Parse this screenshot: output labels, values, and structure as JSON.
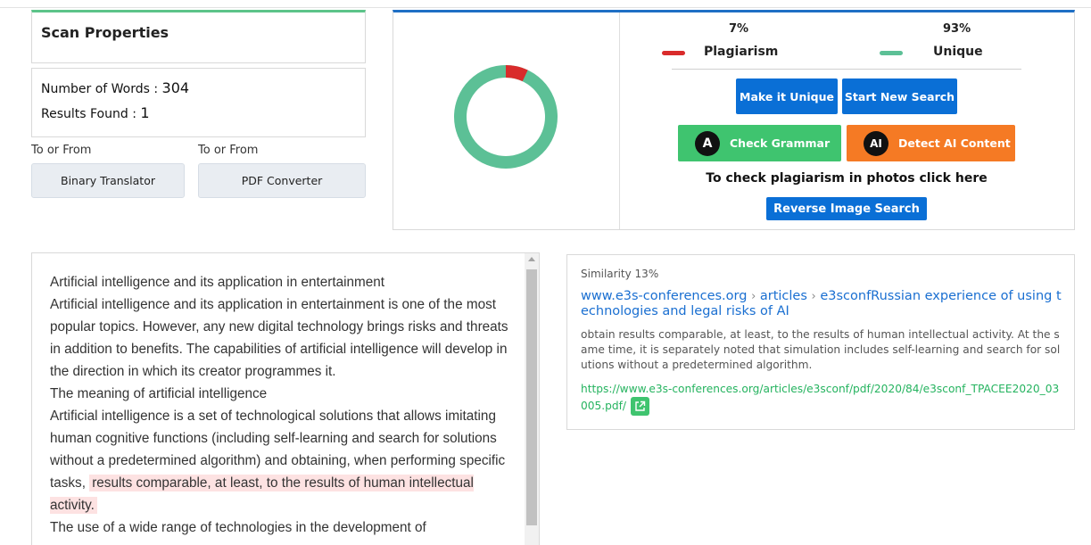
{
  "scan_properties": {
    "title": "Scan Properties",
    "words_label": "Number of Words : ",
    "words_value": "304",
    "results_label": "Results Found : ",
    "results_value": "1"
  },
  "tools": [
    {
      "caption": "To or From",
      "label": "Binary Translator"
    },
    {
      "caption": "To or From",
      "label": "PDF Converter"
    }
  ],
  "result": {
    "plagiarism_pct": "7%",
    "unique_pct": "93%",
    "plagiarism_label": "Plagiarism",
    "unique_label": "Unique",
    "plagiarism_fraction": 0.07,
    "colors": {
      "plagiarism": "#d92b2b",
      "unique": "#5cc096",
      "primary": "#0a6fd6",
      "grammar": "#3fc46f",
      "ai": "#f57a24"
    }
  },
  "actions": {
    "make_unique": "Make it Unique",
    "start_new": "Start New Search",
    "check_grammar": "Check Grammar",
    "detect_ai": "Detect AI Content",
    "grammar_icon": "A",
    "ai_icon": "AI",
    "photo_text": "To check plagiarism in photos click here",
    "reverse_image": "Reverse Image Search"
  },
  "document": {
    "p1": "Artificial intelligence and its application in entertainment",
    "p2": "Artificial intelligence and its application in entertainment is one of the most popular topics. However, any new digital technology brings risks and threats in addition to benefits. The capabilities of artificial intelligence will develop in the direction in which its creator programmes it.",
    "p3": "The meaning of artificial intelligence",
    "p4_plain": "Artificial intelligence is a set of technological solutions that allows imitating human cognitive functions (including self-learning and search for solutions without a predetermined algorithm) and obtaining, when performing specific tasks, ",
    "p4_highlight": "results comparable, at least, to the results of human intellectual activity.",
    "p5": "The use of a wide range of technologies in the development of"
  },
  "similarity": {
    "label": "Similarity 13%",
    "domain": "www.e3s-conferences.org",
    "crumb1": "articles",
    "crumb2": "e3sconfRussian experience of using technologies and legal risks of AI",
    "separator": "›",
    "snippet": "obtain results comparable, at least, to the results of human intellectual activity. At the same time, it is separately noted that simulation includes self-learning and search for solutions without a predetermined algorithm.",
    "url": "https://www.e3s-conferences.org/articles/e3sconf/pdf/2020/84/e3sconf_TPACEE2020_03005.pdf/"
  }
}
